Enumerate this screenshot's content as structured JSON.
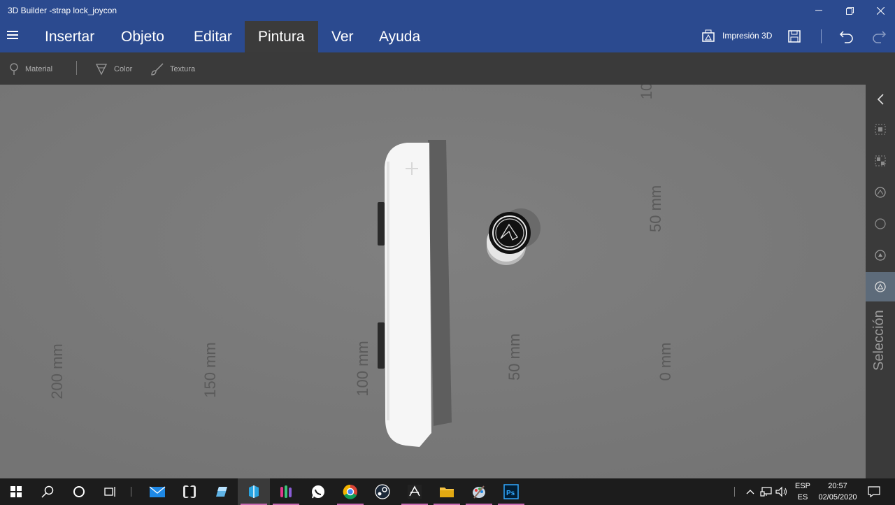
{
  "window": {
    "title": "3D Builder -strap lock_joycon"
  },
  "menu": {
    "items": [
      "Insertar",
      "Objeto",
      "Editar",
      "Pintura",
      "Ver",
      "Ayuda"
    ],
    "active": "Pintura",
    "print3d_label": "Impresión 3D"
  },
  "toolbar": {
    "material_label": "Material",
    "color_label": "Color",
    "texture_label": "Textura"
  },
  "viewport": {
    "axis_labels": {
      "a200": "200 mm",
      "a150": "150 mm",
      "a100": "100 mm",
      "a50b": "50 mm",
      "a0": "0 mm",
      "a50r": "50 mm",
      "a10": "10"
    }
  },
  "sidepanel": {
    "selection_label": "Selección",
    "icons": [
      "chevron-left-icon",
      "group-icon",
      "ungroup-icon",
      "align-icon",
      "circle-icon",
      "settle-icon",
      "select-icon"
    ]
  },
  "taskbar": {
    "language_top": "ESP",
    "language_bottom": "ES",
    "time": "20:57",
    "date": "02/05/2020"
  },
  "colors": {
    "accent": "#2b4a8f",
    "viewport_bg": "#7a7a7a",
    "panel_bg": "#3a3a3a"
  }
}
